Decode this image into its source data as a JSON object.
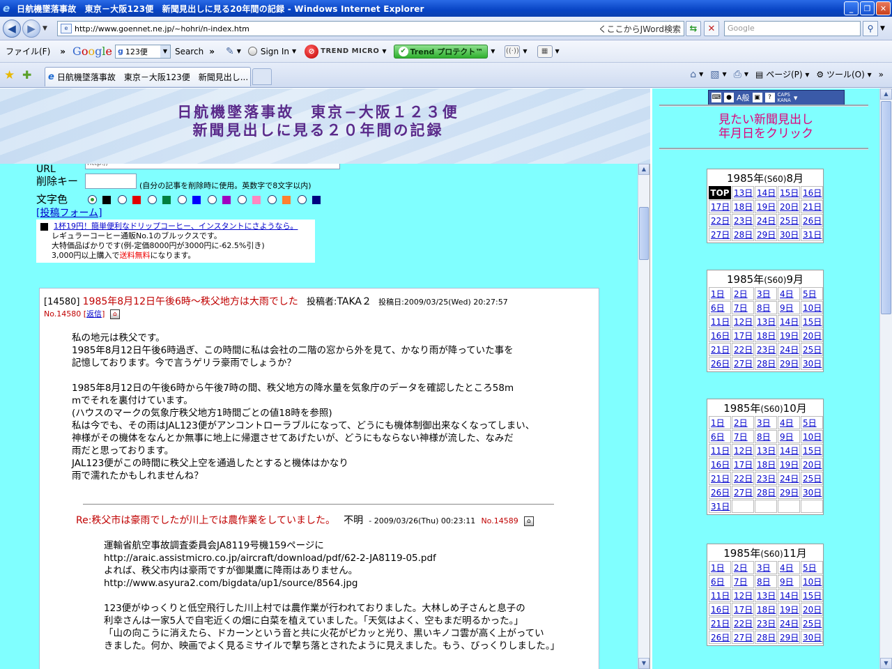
{
  "window": {
    "title": "日航機墜落事故　東京－大阪123便　新聞見出しに見る20年間の記録 - Windows Internet Explorer",
    "min": "_",
    "max": "❐",
    "close": "✕"
  },
  "addressbar": {
    "url": "http://www.goennet.ne.jp/~hohri/n-index.htm",
    "jword": "くここからJWord検索",
    "search_placeholder": "Google"
  },
  "toolbar": {
    "file_menu": "ファイル(F)",
    "google_search_value": "123便",
    "search_label": "Search",
    "signin_label": "Sign In",
    "trend_label": "TREND MICRO",
    "protect_label": "Trend プロテクト™"
  },
  "tabs": [
    {
      "label": "日航機墜落事故　東京－大阪123便　新聞見出し..."
    }
  ],
  "commandbar": {
    "page": "ページ(P)",
    "tools": "ツール(O)"
  },
  "banner": {
    "line1": "日航機墜落事故　東京−大阪１２３便",
    "line2": "新聞見出しに見る２０年間の記録"
  },
  "form": {
    "url_label": "URL",
    "url_value": "http://",
    "delete_key_label": "削除キー",
    "delete_key_note": "(自分の記事を削除時に使用。英数字で8文字以内)",
    "text_color_label": "文字色",
    "post_form_link": "投稿フォーム",
    "colors": [
      "#000000",
      "#e00000",
      "#008040",
      "#0000ff",
      "#a000c0",
      "#ff88c0",
      "#ff8030",
      "#000080"
    ]
  },
  "ad": {
    "headline": "1杯19円！簡単便利なドリップコーヒー、インスタントにさようなら。",
    "line2": "レギュラーコーヒー通販No.1のブルックスです。",
    "line3": "大特価品ばかりです(例-定価8000円が3000円に-62.5%引き)",
    "line4_a": "3,000円以上購入で",
    "line4_red": "送料無料",
    "line4_b": "になります。"
  },
  "post": {
    "id": "[14580]",
    "title": "1985年8月12日午後6時〜秩父地方は大雨でした",
    "author_label": "投稿者:",
    "author": "TAKA２",
    "date": "投稿日:2009/03/25(Wed) 20:27:57",
    "no": "No.14580",
    "reply_link": "返信",
    "body": "私の地元は秩父です。\n1985年8月12日午後6時過ぎ、この時間に私は会社の二階の窓から外を見て、かなり雨が降っていた事を\n記憶しております。今で言うゲリラ豪雨でしょうか？\n\n1985年8月12日の午後6時から午後7時の間、秩父地方の降水量を気象庁のデータを確認したところ58m\nmでそれを裏付けています。\n(ハウスのマークの気象庁秩父地方1時間ごとの値18時を参照)\n私は今でも、その雨はJAL123便がアンコントローラブルになって、どうにも機体制御出来なくなってしまい、\n神様がその機体をなんとか無事に地上に帰還させてあげたいが、どうにもならない神様が流した、なみだ\n雨だと思っております。\nJAL123便がこの時間に秩父上空を通過したとすると機体はかなり\n雨で濡れたかもしれませんね？"
  },
  "reply": {
    "title": "Re:秩父市は豪雨でしたが川上では農作業をしていました。",
    "author": "不明",
    "date": "- 2009/03/26(Thu) 00:23:11",
    "no": "No.14589",
    "body": "運輸省航空事故調査委員会JA8119号機159ページに\nhttp://araic.assistmicro.co.jp/aircraft/download/pdf/62-2-JA8119-05.pdf\nよれば、秩父市内は豪雨ですが御巣鷹に降雨はありません。\nhttp://www.asyura2.com/bigdata/up1/source/8564.jpg\n\n123便がゆっくりと低空飛行した川上村では農作業が行われておりました。大林しめ子さんと息子の\n利幸さんは一家5人で自宅近くの畑に白菜を植えていました。「天気はよく、空もまだ明るかった。」\n「山の向こうに消えたら、ドカーンという音と共に火花がピカッと光り、黒いキノコ雲が高く上がってい\nきました。何か、映画でよく見るミサイルで撃ち落とされたように見えました。もう、びっくりしました。」"
  },
  "sidebar": {
    "instruction_line1": "見たい新聞見出し",
    "instruction_line2": "年月日をクリック",
    "ime_label": "A般",
    "calendars": [
      {
        "title_a": "1985年",
        "title_b": "(S60)",
        "title_c": "8月",
        "days": [
          "TOP",
          "13日",
          "14日",
          "15日",
          "16日",
          "17日",
          "18日",
          "19日",
          "20日",
          "21日",
          "22日",
          "23日",
          "24日",
          "25日",
          "26日",
          "27日",
          "28日",
          "29日",
          "30日",
          "31日"
        ]
      },
      {
        "title_a": "1985年",
        "title_b": "(S60)",
        "title_c": "9月",
        "days": [
          "1日",
          "2日",
          "3日",
          "4日",
          "5日",
          "6日",
          "7日",
          "8日",
          "9日",
          "10日",
          "11日",
          "12日",
          "13日",
          "14日",
          "15日",
          "16日",
          "17日",
          "18日",
          "19日",
          "20日",
          "21日",
          "22日",
          "23日",
          "24日",
          "25日",
          "26日",
          "27日",
          "28日",
          "29日",
          "30日"
        ]
      },
      {
        "title_a": "1985年",
        "title_b": "(S60)",
        "title_c": "10月",
        "days": [
          "1日",
          "2日",
          "3日",
          "4日",
          "5日",
          "6日",
          "7日",
          "8日",
          "9日",
          "10日",
          "11日",
          "12日",
          "13日",
          "14日",
          "15日",
          "16日",
          "17日",
          "18日",
          "19日",
          "20日",
          "21日",
          "22日",
          "23日",
          "24日",
          "25日",
          "26日",
          "27日",
          "28日",
          "29日",
          "30日",
          "31日",
          "",
          "",
          "",
          ""
        ]
      },
      {
        "title_a": "1985年",
        "title_b": "(S60)",
        "title_c": "11月",
        "days": [
          "1日",
          "2日",
          "3日",
          "4日",
          "5日",
          "6日",
          "7日",
          "8日",
          "9日",
          "10日",
          "11日",
          "12日",
          "13日",
          "14日",
          "15日",
          "16日",
          "17日",
          "18日",
          "19日",
          "20日",
          "21日",
          "22日",
          "23日",
          "24日",
          "25日",
          "26日",
          "27日",
          "28日",
          "29日",
          "30日"
        ]
      }
    ]
  }
}
